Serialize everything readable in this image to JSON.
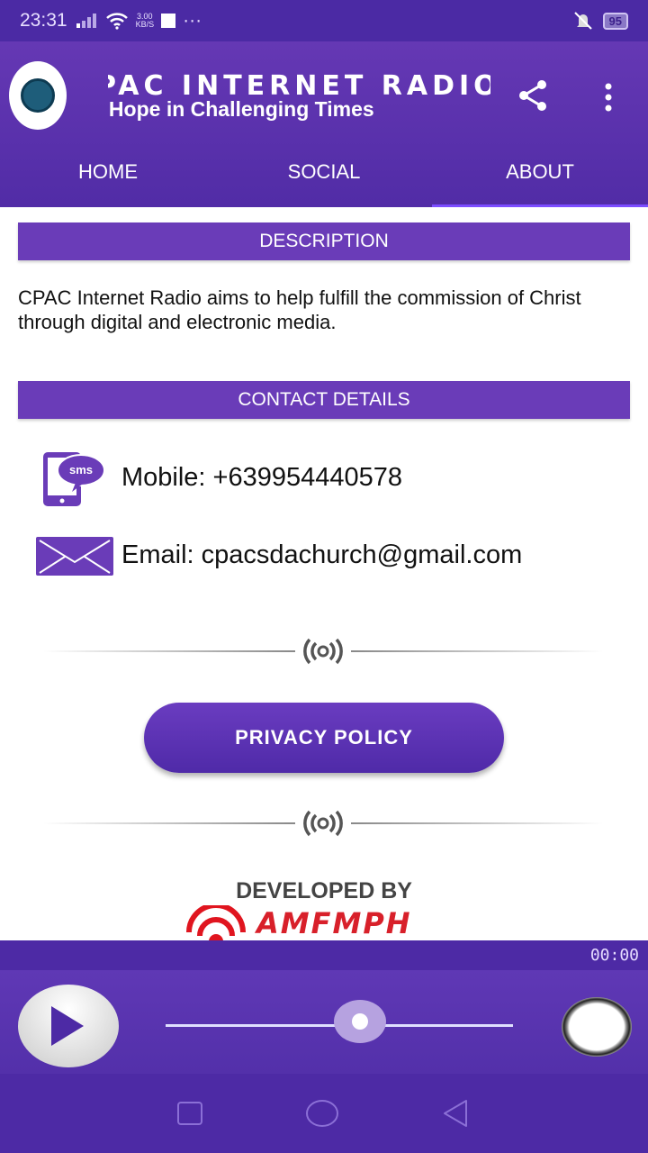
{
  "status_bar": {
    "time": "23:31",
    "net_speed_value": "3.00",
    "net_speed_unit": "KB/S",
    "more": "···",
    "battery": "95"
  },
  "header": {
    "title": "CPAC INTERNET RADIO",
    "subtitle": "Bringing Hope in Challenging Times",
    "logo_text": "CPAC INTERNET RADIO"
  },
  "tabs": [
    {
      "label": "HOME"
    },
    {
      "label": "SOCIAL"
    },
    {
      "label": "ABOUT",
      "active": true
    }
  ],
  "about": {
    "description_heading": "DESCRIPTION",
    "description": "CPAC Internet Radio aims to help fulfill the commission of Christ through digital and electronic media.",
    "contact_heading": "CONTACT DETAILS",
    "mobile": "Mobile: +639954440578",
    "sms_icon_text": "sms",
    "email": "Email: cpacsdachurch@gmail.com",
    "privacy_button": "PRIVACY POLICY",
    "developed_by": "DEVELOPED BY",
    "developer_logo": "AMFMPH"
  },
  "player": {
    "timer": "00:00",
    "volume_fraction": 0.56
  },
  "colors": {
    "primary": "#5c35b0",
    "status_bar": "#4b2aa4",
    "accent": "#7c4dff"
  }
}
